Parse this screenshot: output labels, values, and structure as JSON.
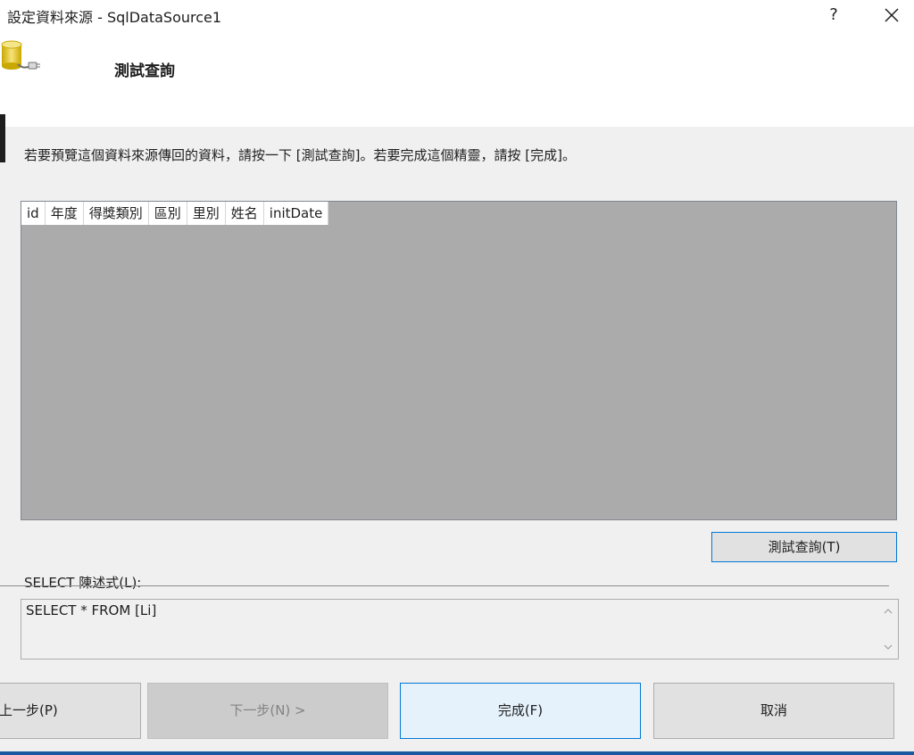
{
  "window": {
    "title": "設定資料來源 - SqlDataSource1",
    "help_label": "?"
  },
  "header": {
    "title": "測試查詢"
  },
  "instruction": "若要預覽這個資料來源傳回的資料，請按一下 [測試查詢]。若要完成這個精靈，請按 [完成]。",
  "grid": {
    "columns": [
      "id",
      "年度",
      "得獎類別",
      "區別",
      "里別",
      "姓名",
      "initDate"
    ]
  },
  "test_query_button": "測試查詢(T)",
  "select_statement": {
    "label": "SELECT 陳述式(L):",
    "value": "SELECT * FROM [Li]"
  },
  "footer": {
    "back_label": "上一步(P)",
    "next_label": "下一步(N) >",
    "finish_label": "完成(F)",
    "cancel_label": "取消"
  },
  "colors": {
    "grid_background": "#ababab",
    "accent_blue": "#0078d7",
    "finish_button_bg": "#e5f1fb"
  }
}
